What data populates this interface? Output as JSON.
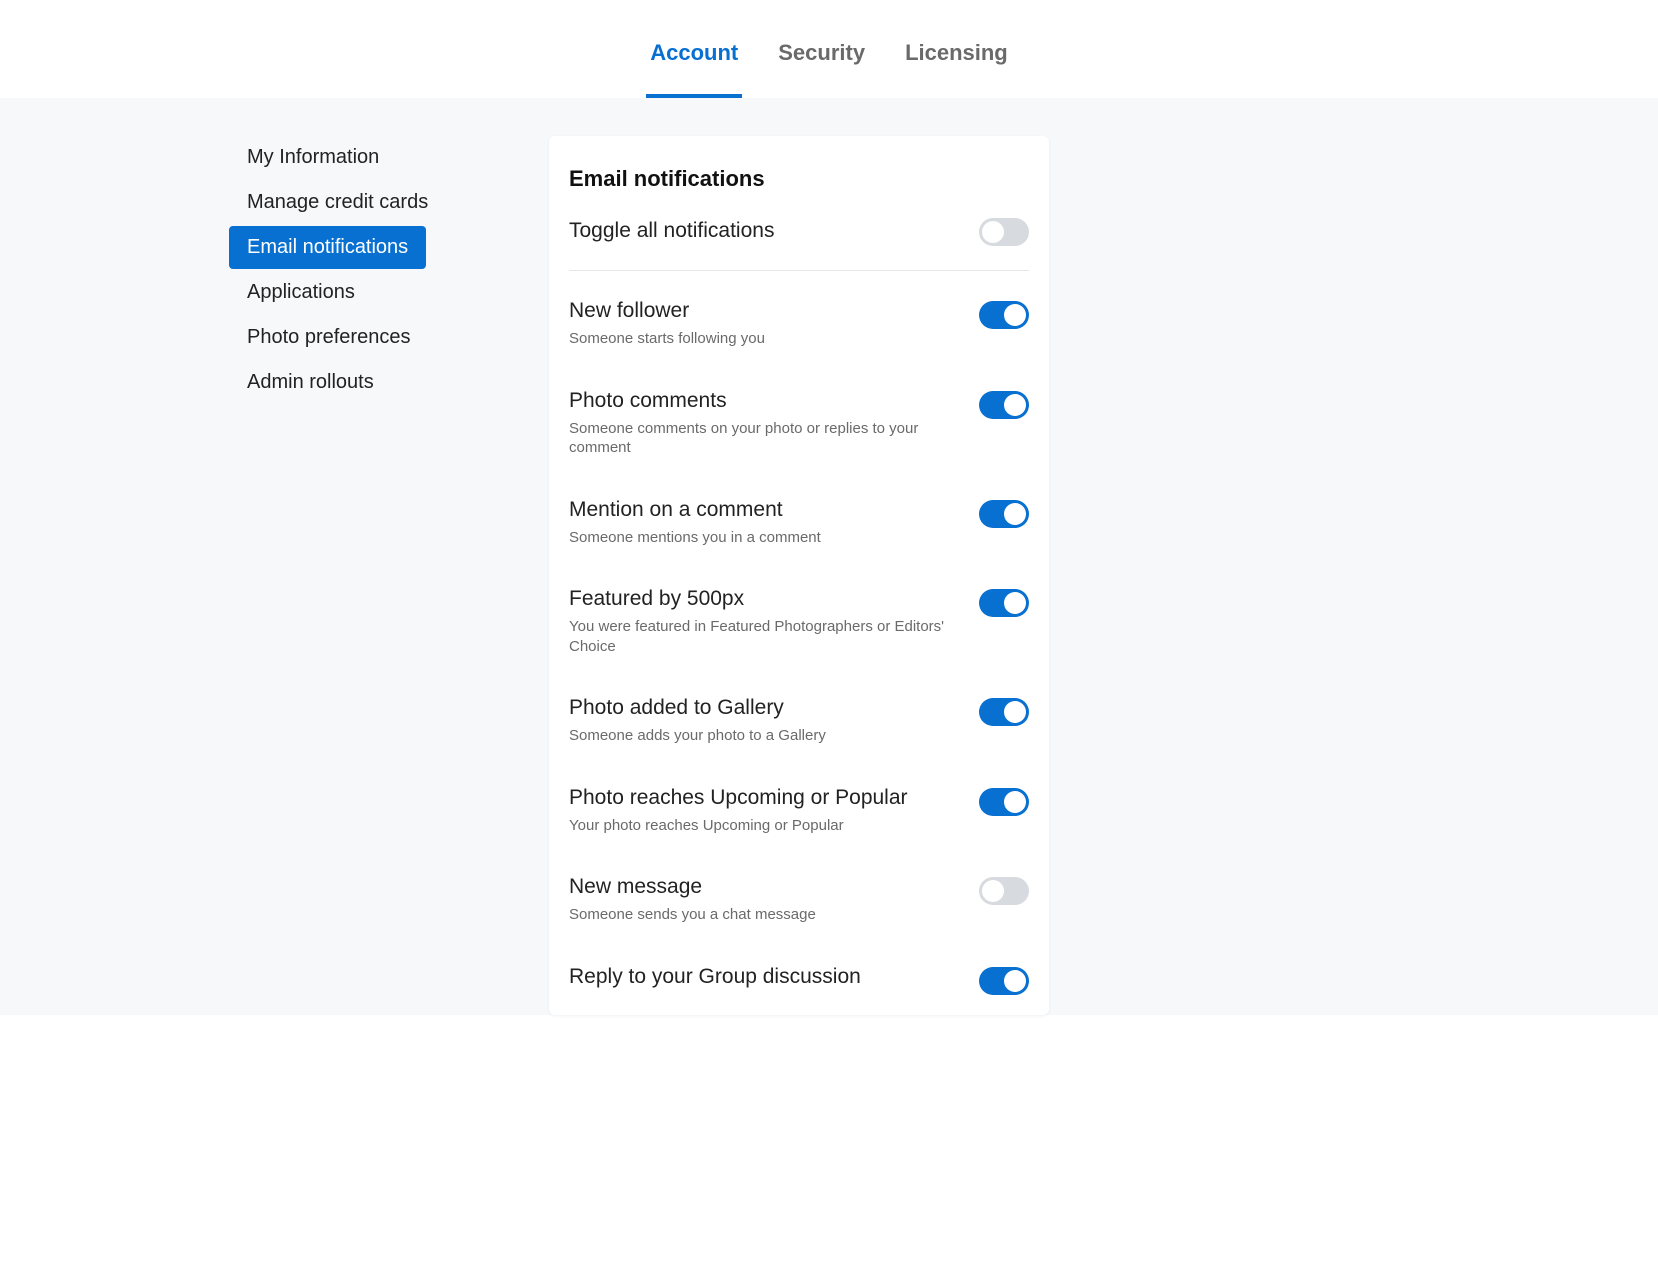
{
  "tabs": [
    {
      "label": "Account",
      "active": true
    },
    {
      "label": "Security",
      "active": false
    },
    {
      "label": "Licensing",
      "active": false
    }
  ],
  "sidebar": {
    "items": [
      {
        "label": "My Information",
        "active": false
      },
      {
        "label": "Manage credit cards",
        "active": false
      },
      {
        "label": "Email notifications",
        "active": true
      },
      {
        "label": "Applications",
        "active": false
      },
      {
        "label": "Photo preferences",
        "active": false
      },
      {
        "label": "Admin rollouts",
        "active": false
      }
    ]
  },
  "panel": {
    "title": "Email notifications",
    "master": {
      "title": "Toggle all notifications",
      "enabled": false
    },
    "items": [
      {
        "title": "New follower",
        "desc": "Someone starts following you",
        "enabled": true
      },
      {
        "title": "Photo comments",
        "desc": "Someone comments on your photo or replies to your comment",
        "enabled": true
      },
      {
        "title": "Mention on a comment",
        "desc": "Someone mentions you in a comment",
        "enabled": true
      },
      {
        "title": "Featured by 500px",
        "desc": "You were featured in Featured Photographers or Editors' Choice",
        "enabled": true
      },
      {
        "title": "Photo added to Gallery",
        "desc": "Someone adds your photo to a Gallery",
        "enabled": true
      },
      {
        "title": "Photo reaches Upcoming or Popular",
        "desc": "Your photo reaches Upcoming or Popular",
        "enabled": true
      },
      {
        "title": "New message",
        "desc": "Someone sends you a chat message",
        "enabled": false
      },
      {
        "title": "Reply to your Group discussion",
        "desc": "",
        "enabled": true
      }
    ]
  }
}
